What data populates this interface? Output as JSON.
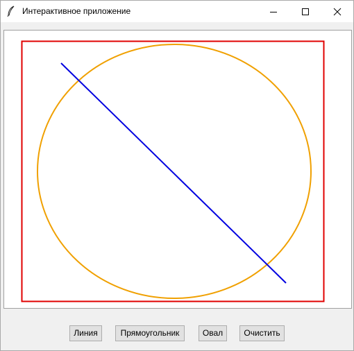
{
  "window": {
    "title": "Интерактивное приложение",
    "icon": "feather-icon",
    "controls": {
      "minimize_icon": "minimize-icon",
      "maximize_icon": "maximize-icon",
      "close_icon": "close-icon"
    }
  },
  "canvas": {
    "background": "#ffffff",
    "shapes": [
      {
        "type": "rectangle",
        "color": "#e00000"
      },
      {
        "type": "oval",
        "color": "#f0a000"
      },
      {
        "type": "line",
        "color": "#0000e0"
      }
    ]
  },
  "toolbar": {
    "line_label": "Линия",
    "rectangle_label": "Прямоугольник",
    "oval_label": "Овал",
    "clear_label": "Очистить"
  }
}
